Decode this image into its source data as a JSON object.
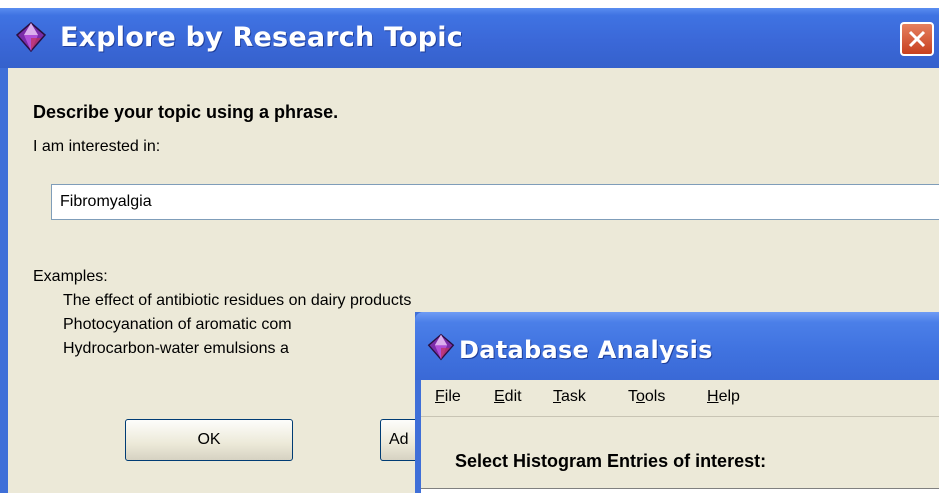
{
  "explore_window": {
    "title": "Explore by Research Topic",
    "heading": "Describe your topic using a phrase.",
    "prompt": "I am interested in:",
    "topic_value": "Fibromyalgia",
    "examples_label": "Examples:",
    "examples": [
      "The effect of antibiotic residues on dairy products",
      "Photocyanation of aromatic com",
      "Hydrocarbon-water emulsions a"
    ],
    "ok_label": "OK",
    "add_label": "Ad"
  },
  "analysis_window": {
    "title": "Database Analysis",
    "menu": [
      "File",
      "Edit",
      "Task",
      "Tools",
      "Help"
    ],
    "select_label": "Select Histogram Entries of interest:"
  },
  "colors": {
    "titlebar_blue": "#3b68d8",
    "window_face": "#ece9d8",
    "close_red": "#c8401f"
  },
  "icons": {
    "app": "diamond-gem-icon",
    "close": "close-icon"
  }
}
